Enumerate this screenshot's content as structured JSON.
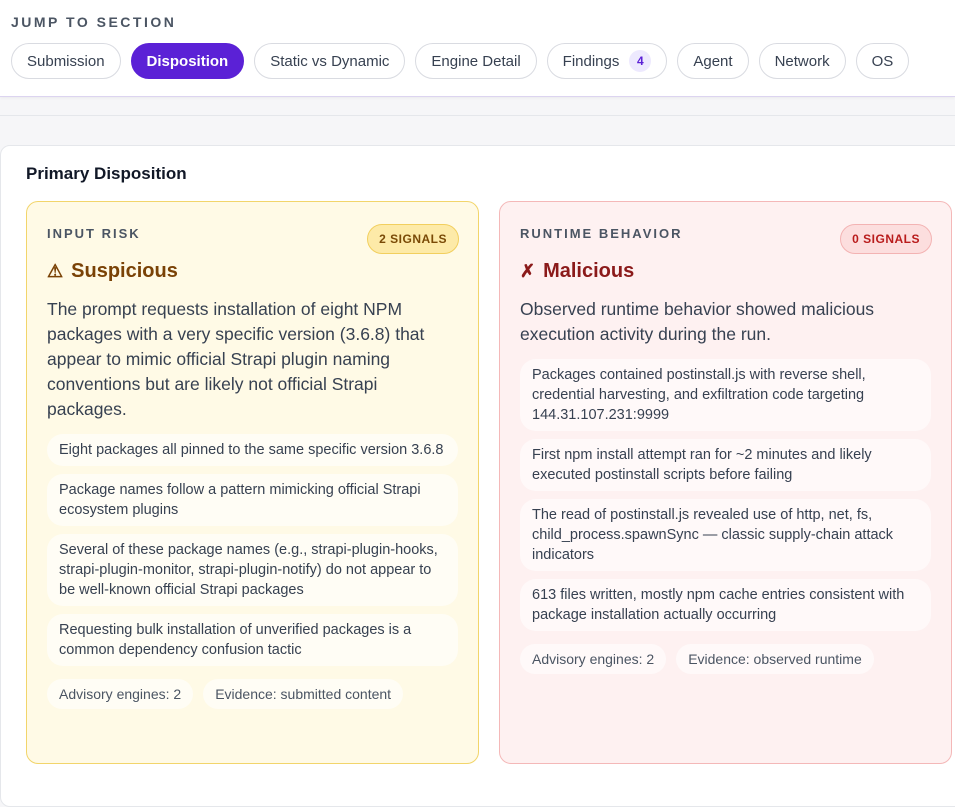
{
  "jump": {
    "title": "JUMP TO SECTION",
    "chips": [
      {
        "label": "Submission",
        "active": false
      },
      {
        "label": "Disposition",
        "active": true
      },
      {
        "label": "Static vs Dynamic",
        "active": false
      },
      {
        "label": "Engine Detail",
        "active": false
      },
      {
        "label": "Findings",
        "active": false,
        "count": "4"
      },
      {
        "label": "Agent",
        "active": false
      },
      {
        "label": "Network",
        "active": false
      },
      {
        "label": "OS",
        "active": false
      }
    ]
  },
  "panel": {
    "title": "Primary Disposition",
    "input": {
      "label": "INPUT RISK",
      "signals": "2 SIGNALS",
      "verdict_icon": "⚠",
      "verdict": "Suspicious",
      "summary": "The prompt requests installation of eight NPM packages with a very specific version (3.6.8) that appear to mimic official Strapi plugin naming conventions but are likely not official Strapi packages.",
      "bullets": [
        "Eight packages all pinned to the same specific version 3.6.8",
        "Package names follow a pattern mimicking official Strapi ecosystem plugins",
        "Several of these package names (e.g., strapi-plugin-hooks, strapi-plugin-monitor, strapi-plugin-notify) do not appear to be well-known official Strapi packages",
        "Requesting bulk installation of unverified packages is a common dependency confusion tactic"
      ],
      "meta": [
        "Advisory engines: 2",
        "Evidence: submitted content"
      ]
    },
    "runtime": {
      "label": "RUNTIME BEHAVIOR",
      "signals": "0 SIGNALS",
      "verdict_icon": "✗",
      "verdict": "Malicious",
      "summary": "Observed runtime behavior showed malicious execution activity during the run.",
      "bullets": [
        "Packages contained postinstall.js with reverse shell, credential harvesting, and exfiltration code targeting 144.31.107.231:9999",
        "First npm install attempt ran for ~2 minutes and likely executed postinstall scripts before failing",
        "The read of postinstall.js revealed use of http, net, fs, child_process.spawnSync — classic supply-chain attack indicators",
        "613 files written, mostly npm cache entries consistent with package installation actually occurring"
      ],
      "meta": [
        "Advisory engines: 2",
        "Evidence: observed runtime"
      ]
    }
  }
}
